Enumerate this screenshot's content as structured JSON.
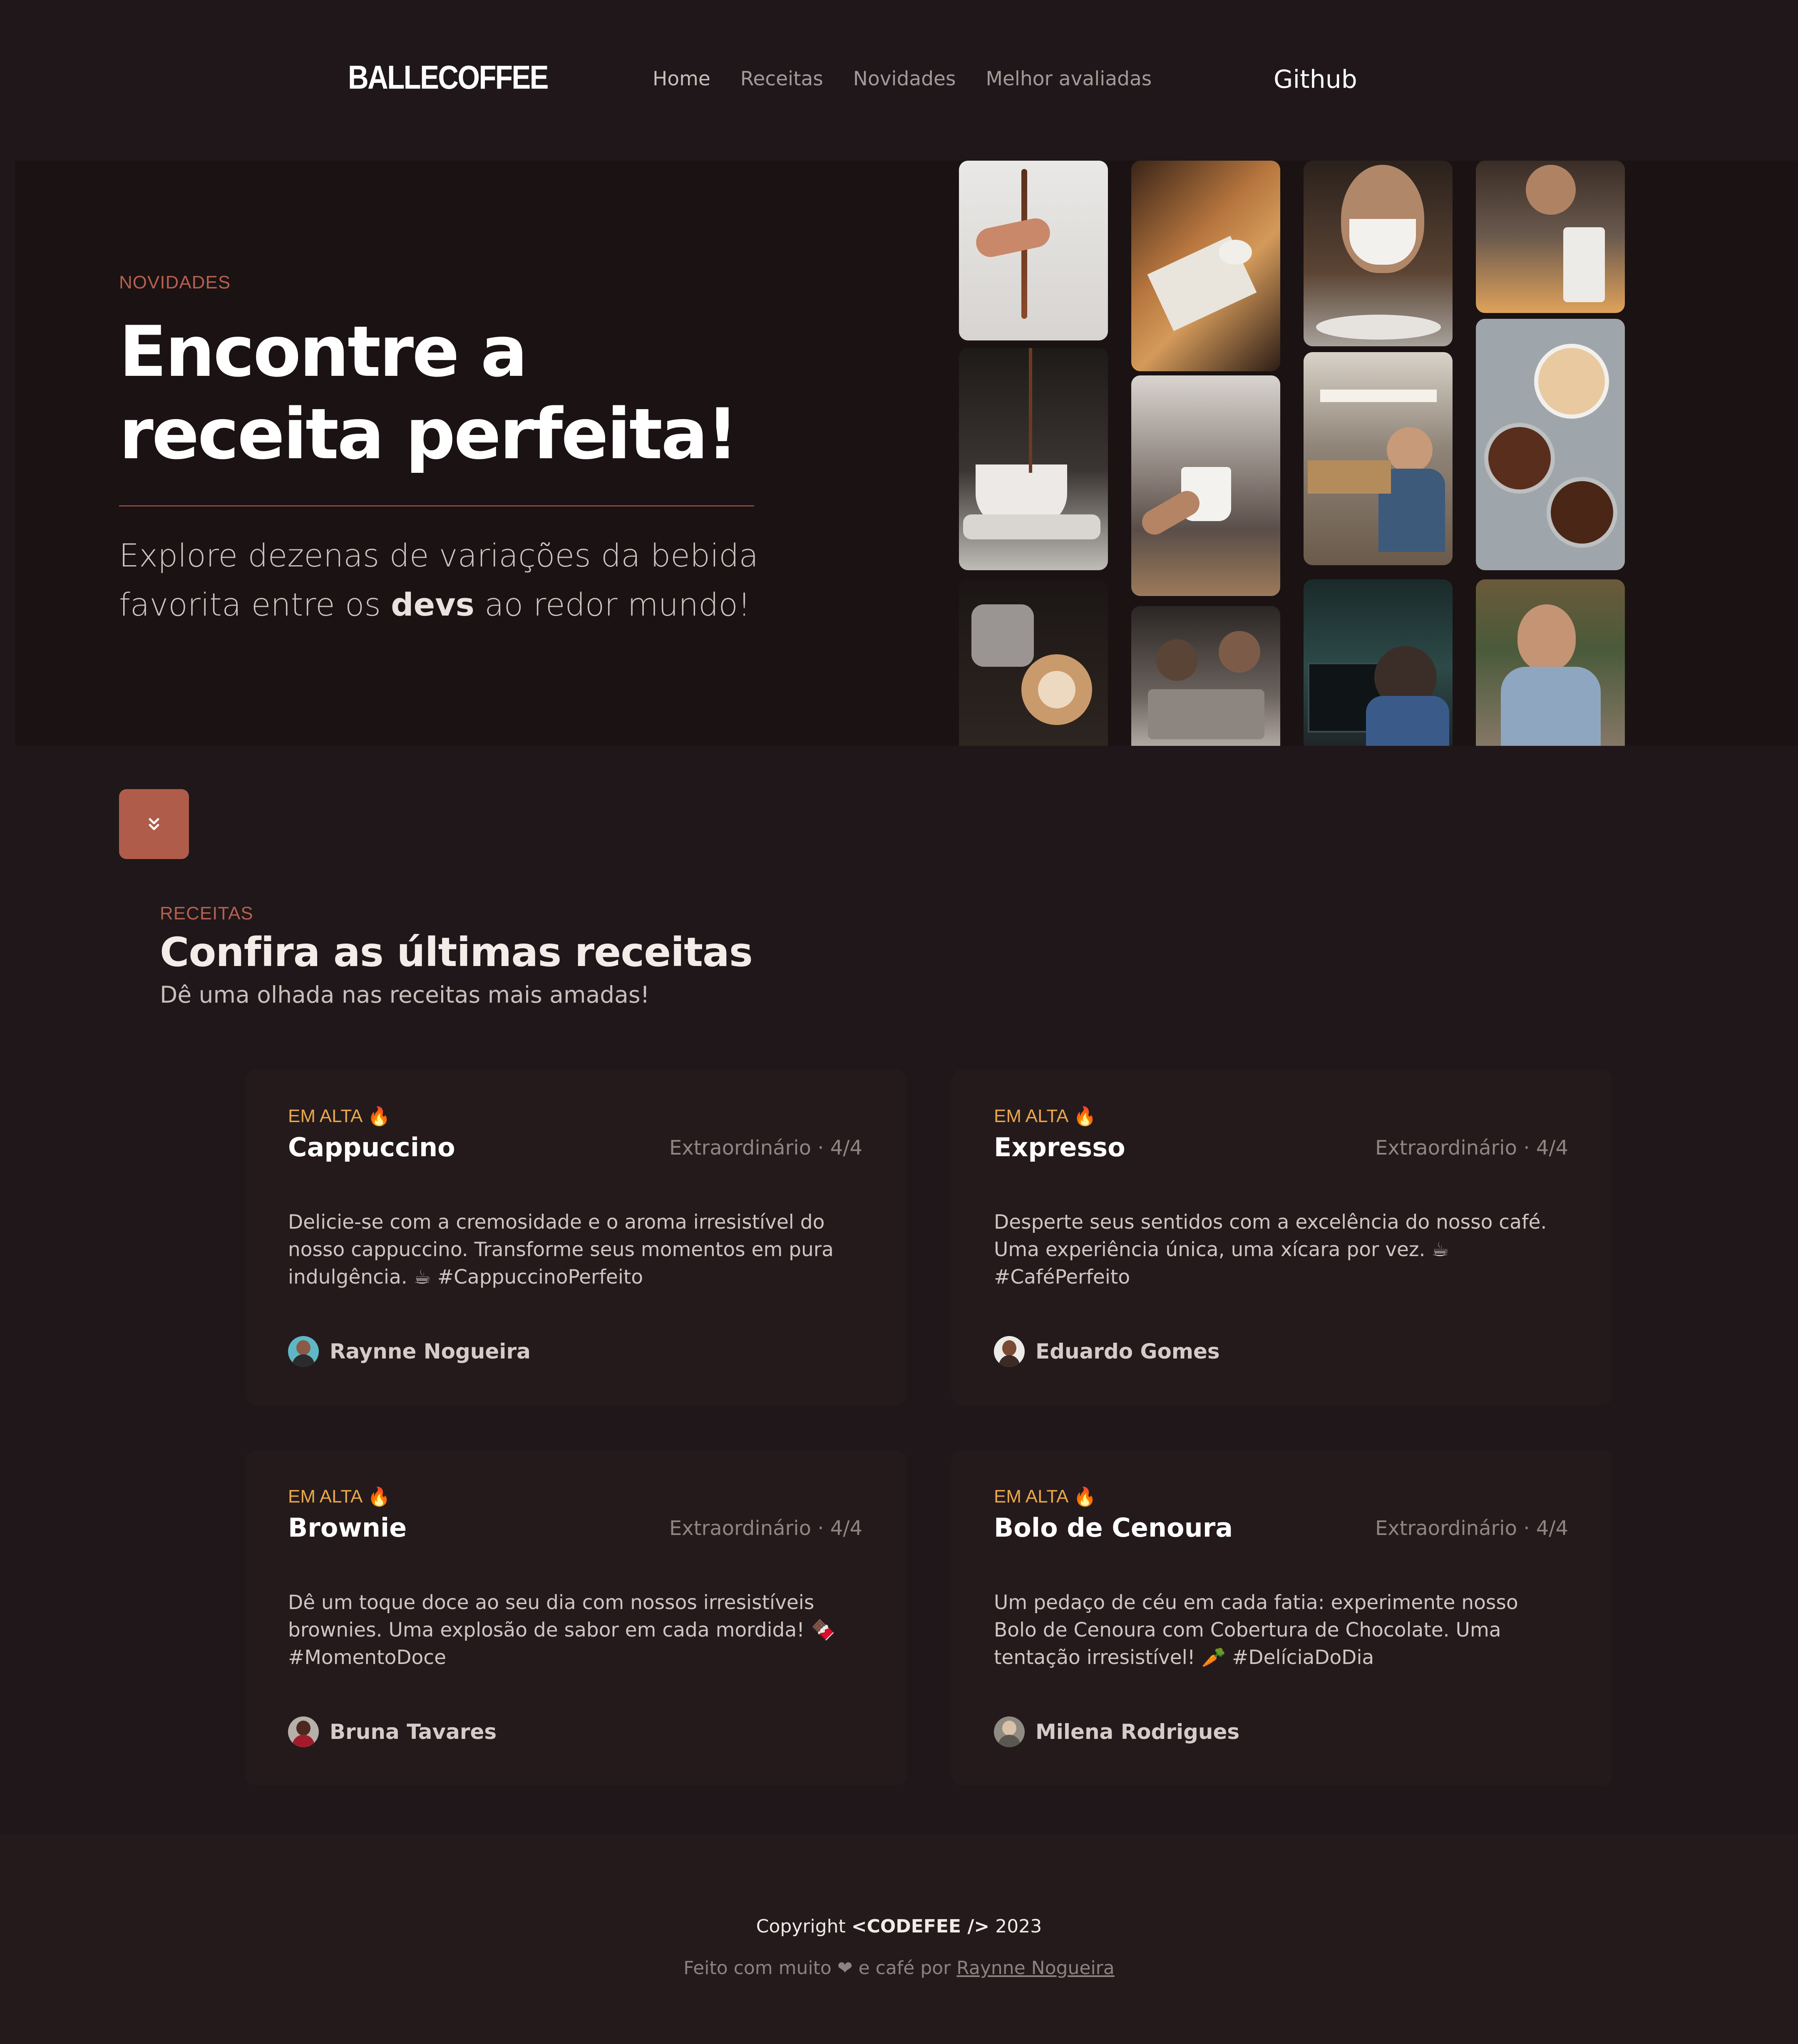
{
  "nav": {
    "logo": "BALLECOFFEE",
    "links": [
      "Home",
      "Receitas",
      "Novidades",
      "Melhor avaliadas"
    ],
    "github": "Github"
  },
  "hero": {
    "eyebrow": "NOVIDADES",
    "title_line1": "Encontre a",
    "title_line2": "receita perfeita!",
    "sub_before": "Explore dezenas de variações da bebida favorita entre os ",
    "sub_bold": "devs",
    "sub_after": " ao redor mundo!"
  },
  "scroll_icon": "double-chevron-down-icon",
  "recipes": {
    "eyebrow": "RECEITAS",
    "title": "Confira as últimas receitas",
    "subtitle": "Dê uma olhada nas receitas mais amadas!",
    "cards": [
      {
        "badge": "EM ALTA",
        "name": "Cappuccino",
        "rating": "Extraordinário · 4/4",
        "description": "Delicie-se com a cremosidade e o aroma irresistível do nosso cappuccino. Transforme seus momentos em pura indulgência. ☕ #CappuccinoPerfeito",
        "author": "Raynne Nogueira"
      },
      {
        "badge": "EM ALTA",
        "name": "Expresso",
        "rating": "Extraordinário · 4/4",
        "description": "Desperte seus sentidos com a excelência do nosso café. Uma experiência única, uma xícara por vez. ☕ #CaféPerfeito",
        "author": "Eduardo Gomes"
      },
      {
        "badge": "EM ALTA",
        "name": "Brownie",
        "rating": "Extraordinário · 4/4",
        "description": "Dê um toque doce ao seu dia com nossos irresistíveis brownies. Uma explosão de sabor em cada mordida! 🍫 #MomentoDoce",
        "author": "Bruna Tavares"
      },
      {
        "badge": "EM ALTA",
        "name": "Bolo de Cenoura",
        "rating": "Extraordinário · 4/4",
        "description": "Um pedaço de céu em cada fatia: experimente nosso Bolo de Cenoura com Cobertura de Chocolate. Uma tentação irresistível! 🥕 #DelíciaDoDia",
        "author": "Milena Rodrigues"
      }
    ]
  },
  "footer": {
    "copyright_before": "Copyright ",
    "copyright_bold": "<CODEFEE />",
    "copyright_after": " 2023",
    "made_before": "Feito com muito ",
    "made_heart": "❤",
    "made_middle": " e café por ",
    "made_link": "Raynne Nogueira"
  },
  "colors": {
    "background": "#1f1719",
    "hero_bg": "#1a1213",
    "accent": "#b05c4b",
    "badge": "#e9a84a",
    "card_bg": "#241a1c"
  }
}
